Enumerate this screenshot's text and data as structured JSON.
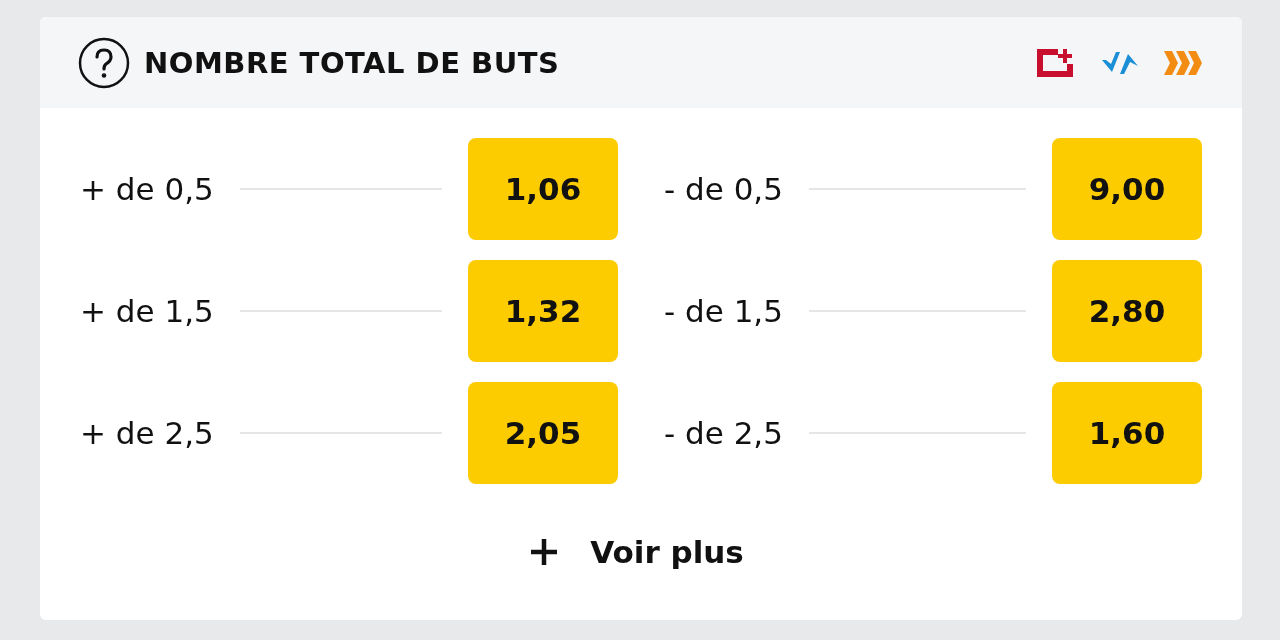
{
  "header": {
    "title": "NOMBRE TOTAL DE BUTS"
  },
  "rows": [
    {
      "over": {
        "label": "+ de 0,5",
        "odds": "1,06"
      },
      "under": {
        "label": "- de 0,5",
        "odds": "9,00"
      }
    },
    {
      "over": {
        "label": "+ de 1,5",
        "odds": "1,32"
      },
      "under": {
        "label": "- de 1,5",
        "odds": "2,80"
      }
    },
    {
      "over": {
        "label": "+ de 2,5",
        "odds": "2,05"
      },
      "under": {
        "label": "- de 2,5",
        "odds": "1,60"
      }
    }
  ],
  "more_button": {
    "label": "Voir plus"
  }
}
